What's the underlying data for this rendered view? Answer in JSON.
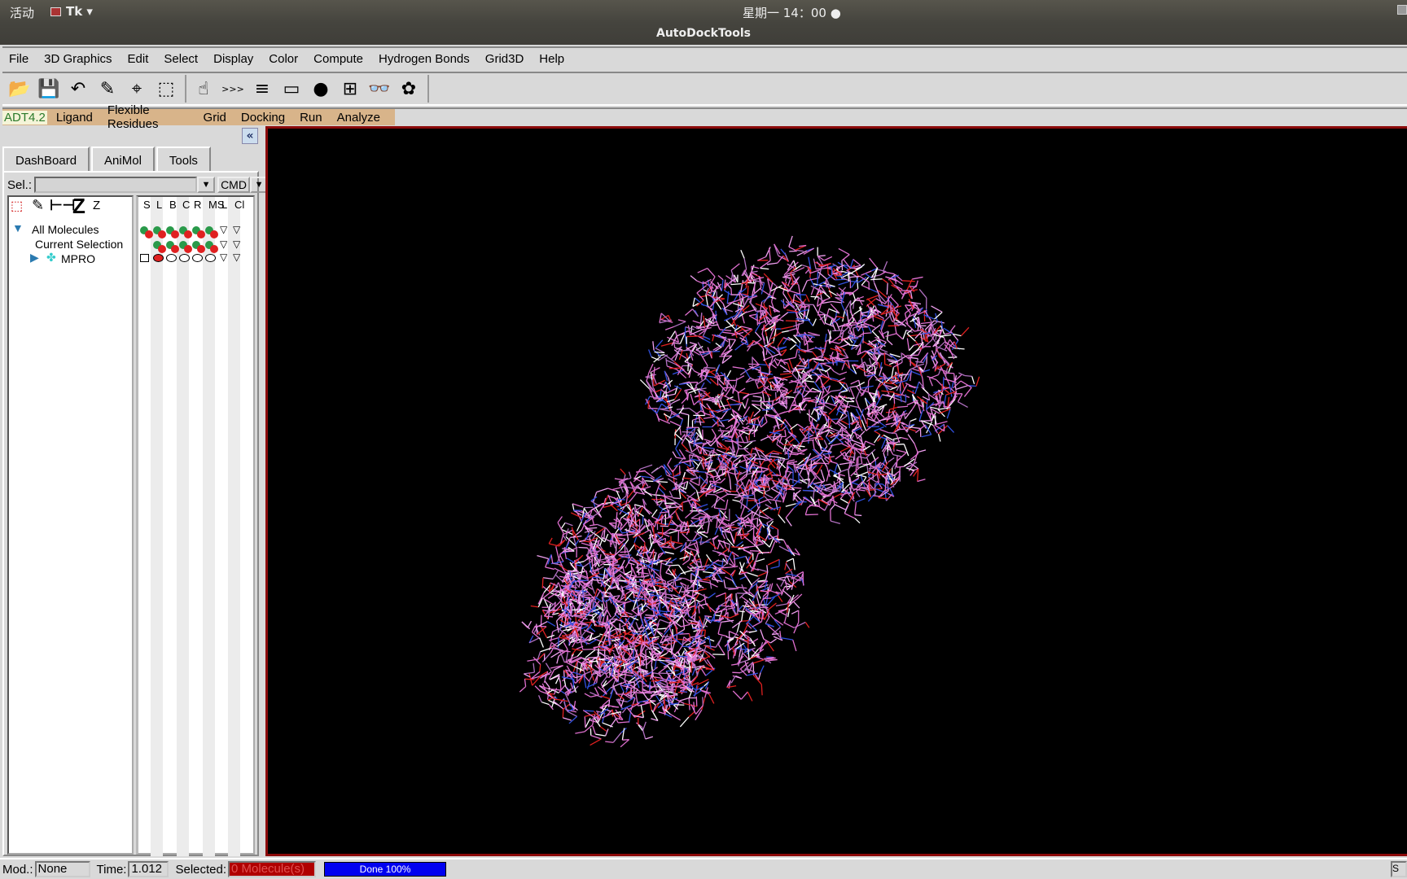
{
  "topbar": {
    "activities": "活动",
    "app": "Tk ▾",
    "clock": "星期一 14：00 ●"
  },
  "window": {
    "title": "AutoDockTools"
  },
  "menu": [
    "File",
    "3D Graphics",
    "Edit",
    "Select",
    "Display",
    "Color",
    "Compute",
    "Hydrogen Bonds",
    "Grid3D",
    "Help"
  ],
  "toolbar": [
    {
      "icon": "open-folder-icon",
      "glyph": "📂"
    },
    {
      "icon": "save-floppy-icon",
      "glyph": "💾"
    },
    {
      "icon": "undo-arrow-icon",
      "glyph": "↶"
    },
    {
      "icon": "pencil-icon",
      "glyph": "✎"
    },
    {
      "icon": "crosshair-center-icon",
      "glyph": "⌖"
    },
    {
      "icon": "select-delete-icon",
      "glyph": "⬚"
    },
    {
      "icon": "pick-hand-icon",
      "glyph": "☝"
    },
    {
      "icon": "python-shell-icon",
      "glyph": ">>>"
    },
    {
      "icon": "log-lines-icon",
      "glyph": "≡"
    },
    {
      "icon": "display-panel-icon",
      "glyph": "▭"
    },
    {
      "icon": "color-shapes-icon",
      "glyph": "●"
    },
    {
      "icon": "tree-hierarchy-icon",
      "glyph": "⊞"
    },
    {
      "icon": "stereo-glasses-icon",
      "glyph": "👓"
    },
    {
      "icon": "molecule-blob-icon",
      "glyph": "✿"
    }
  ],
  "adt": [
    "ADT4.2",
    "Ligand",
    "Flexible Residues",
    "Grid",
    "Docking",
    "Run",
    "Analyze"
  ],
  "left": {
    "tabs": [
      "DashBoard",
      "AniMol",
      "Tools"
    ],
    "sel_label": "Sel.:",
    "sel_value": "",
    "cmd": "CMD",
    "col_headers": [
      "S",
      "L",
      "B",
      "C",
      "R",
      "MS",
      "L",
      "Cl"
    ],
    "tree": {
      "all": "All Molecules",
      "current": "Current Selection",
      "mol": "MPRO"
    }
  },
  "status": {
    "mod_label": "Mod.:",
    "mod": "None",
    "time_label": "Time:",
    "time": "1.012",
    "selected_label": "Selected:",
    "selected": "0 Molecule(s)",
    "progress": "Done 100%",
    "progress_pct": 100
  },
  "colors": {
    "viewer_bg": "#000000",
    "viewer_border": "#8b0a0a",
    "bond_carbon": "#e070d0",
    "bond_nitrogen": "#3050e0",
    "bond_oxygen": "#e02020",
    "progress": "#0000f0"
  }
}
